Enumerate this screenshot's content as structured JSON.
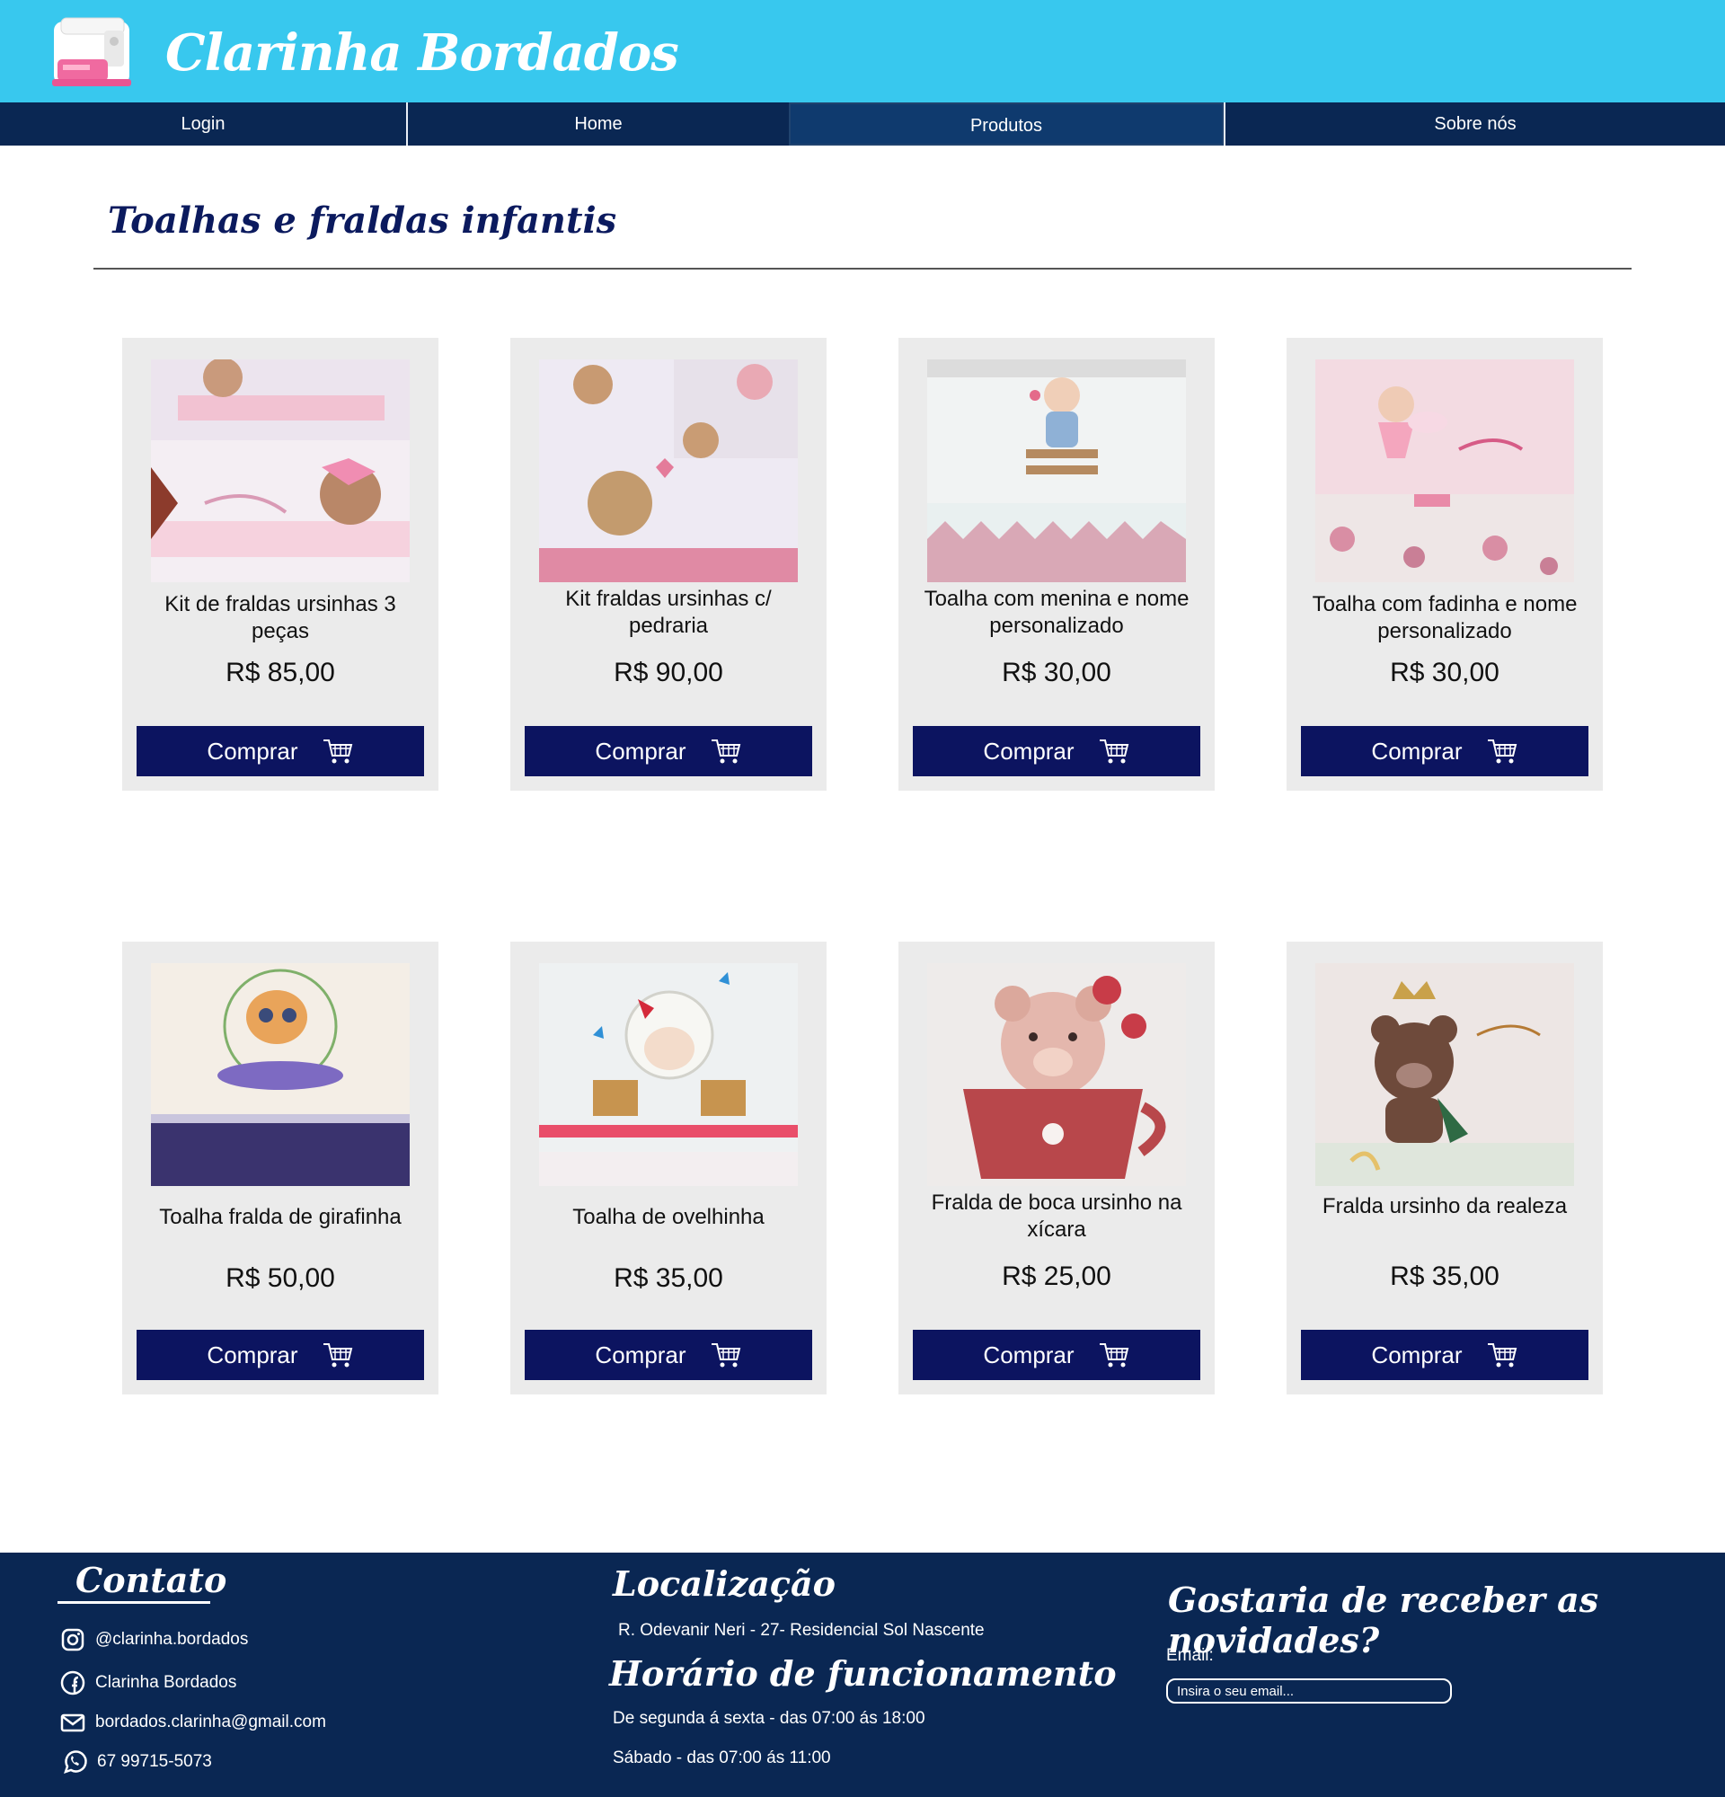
{
  "header": {
    "brand": "Clarinha Bordados"
  },
  "nav": {
    "items": [
      {
        "label": "Login"
      },
      {
        "label": "Home"
      },
      {
        "label": "Produtos"
      },
      {
        "label": "Sobre nós"
      }
    ]
  },
  "section": {
    "title": "Toalhas e fraldas infantis"
  },
  "products": [
    {
      "name": "Kit de fraldas ursinhas 3 peças",
      "price": "R$ 85,00",
      "buy_label": "Comprar"
    },
    {
      "name": "Kit fraldas ursinhas c/ pedraria",
      "price": "R$ 90,00",
      "buy_label": "Comprar"
    },
    {
      "name": "Toalha com menina e nome personalizado",
      "price": "R$ 30,00",
      "buy_label": "Comprar"
    },
    {
      "name": "Toalha com fadinha e nome personalizado",
      "price": "R$ 30,00",
      "buy_label": "Comprar"
    },
    {
      "name": "Toalha fralda de girafinha",
      "price": "R$ 50,00",
      "buy_label": "Comprar"
    },
    {
      "name": "Toalha de ovelhinha",
      "price": "R$ 35,00",
      "buy_label": "Comprar"
    },
    {
      "name": "Fralda de boca ursinho na xícara",
      "price": "R$ 25,00",
      "buy_label": "Comprar"
    },
    {
      "name": "Fralda ursinho da realeza",
      "price": "R$ 35,00",
      "buy_label": "Comprar"
    }
  ],
  "footer": {
    "contact_title": "Contato",
    "instagram": "@clarinha.bordados",
    "facebook": "Clarinha Bordados",
    "email": "bordados.clarinha@gmail.com",
    "phone": "67 99715-5073",
    "location_title": "Localização",
    "address": "R. Odevanir Neri - 27- Residencial Sol Nascente",
    "hours_title": "Horário de funcionamento",
    "hours_week": "De segunda á sexta - das 07:00 ás 18:00",
    "hours_saturday": "Sábado - das 07:00 ás 11:00",
    "newsletter_title": "Gostaria de receber as novidades?",
    "email_label": "Email:",
    "email_placeholder": "Insira o seu email..."
  },
  "colors": {
    "header": "#38c8ee",
    "nav": "#0a2753",
    "button": "#0c1460",
    "card": "#ebebeb",
    "footer": "#0a2753"
  },
  "icons": [
    "sewing-machine-logo",
    "cart-icon",
    "instagram-icon",
    "facebook-icon",
    "mail-icon",
    "whatsapp-icon"
  ]
}
